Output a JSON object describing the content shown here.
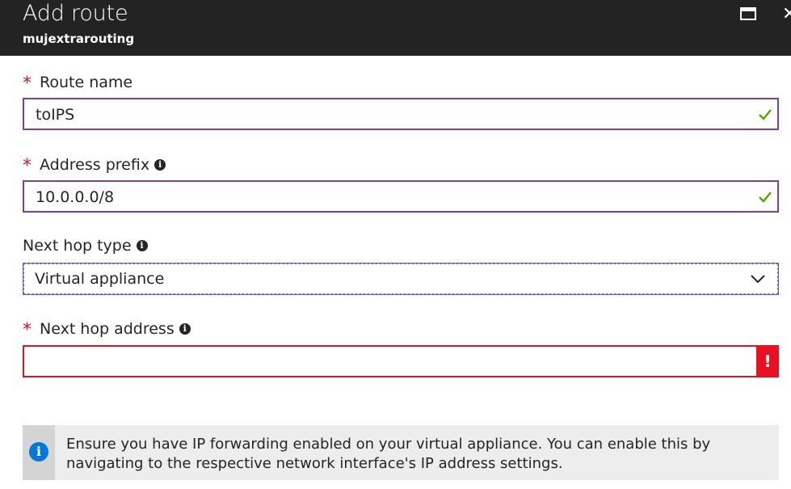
{
  "header": {
    "title": "Add route",
    "subtitle": "mujextrarouting",
    "maximize_icon": "maximize-icon",
    "close_glyph": "✕"
  },
  "form": {
    "required_marker": "*",
    "route_name": {
      "label": "Route name",
      "value": "toIPS",
      "required": true,
      "status": "valid"
    },
    "address_prefix": {
      "label": "Address prefix",
      "value": "10.0.0.0/8",
      "required": true,
      "status": "valid"
    },
    "next_hop_type": {
      "label": "Next hop type",
      "value": "Virtual appliance",
      "required": false
    },
    "next_hop_address": {
      "label": "Next hop address",
      "value": "",
      "required": true,
      "status": "error",
      "error_glyph": "!"
    }
  },
  "info": {
    "glyph": "i",
    "text": "Ensure you have IP forwarding enabled on your virtual appliance. You can enable this by navigating to the respective network interface's IP address settings."
  },
  "colors": {
    "header_bg": "#232323",
    "required": "#e81123",
    "valid_border": "#7b3fa0",
    "check": "#57a300",
    "error": "#e81123",
    "info_icon": "#0078d7"
  }
}
